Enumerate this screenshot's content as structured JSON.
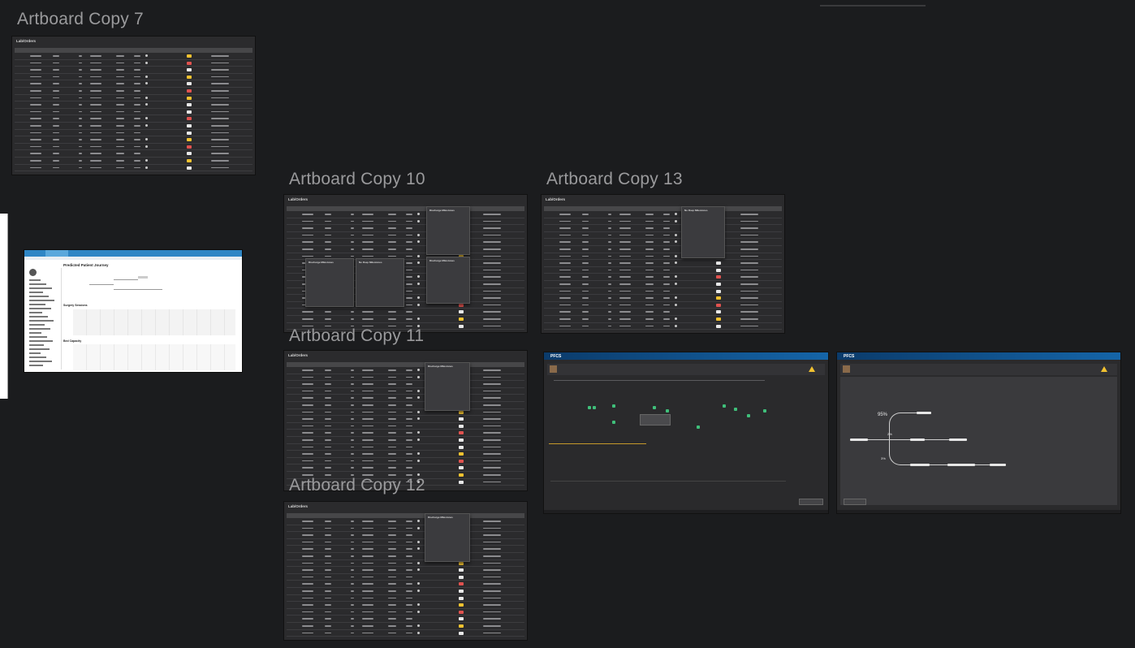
{
  "artboards": {
    "copy7": "Artboard Copy 7",
    "copy10": "Artboard Copy 10",
    "copy11": "Artboard Copy 11",
    "copy12": "Artboard Copy 12",
    "copy13": "Artboard Copy 13"
  },
  "board_title": "Lab/Orders",
  "popup": {
    "discharge_milestones": "Discharge Milestones",
    "no_dsp_milestones": "No Dsep Milestones"
  },
  "pfcs": {
    "app_name": "PFCS",
    "percent_95": "95%",
    "percent_2": "2%",
    "percent_3": "3%"
  },
  "light_board": {
    "title": "Predicted Patient Journey",
    "section_surgery": "Surgery Sessions",
    "section_bed": "Bed Capacity"
  },
  "colors": {
    "background": "#1b1c1e",
    "artboard_dark": "#2b2b2d",
    "badge_yellow": "#f2c230",
    "badge_red": "#e0524f",
    "pfcs_blue": "#1565a8",
    "icon_green": "#3fbf7a"
  }
}
